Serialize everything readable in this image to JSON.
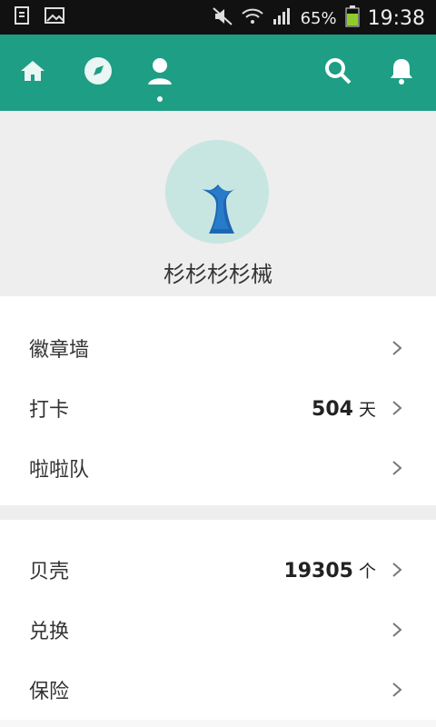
{
  "status_bar": {
    "battery_percent": "65%",
    "time": "19:38"
  },
  "profile": {
    "username": "杉杉杉杉械"
  },
  "section1": [
    {
      "label": "徽章墙",
      "value": "",
      "unit": ""
    },
    {
      "label": "打卡",
      "value": "504",
      "unit": "天"
    },
    {
      "label": "啦啦队",
      "value": "",
      "unit": ""
    }
  ],
  "section2": [
    {
      "label": "贝壳",
      "value": "19305",
      "unit": "个"
    },
    {
      "label": "兑换",
      "value": "",
      "unit": ""
    },
    {
      "label": "保险",
      "value": "",
      "unit": ""
    }
  ],
  "colors": {
    "accent": "#1e9e84",
    "statusbar": "#111111"
  }
}
